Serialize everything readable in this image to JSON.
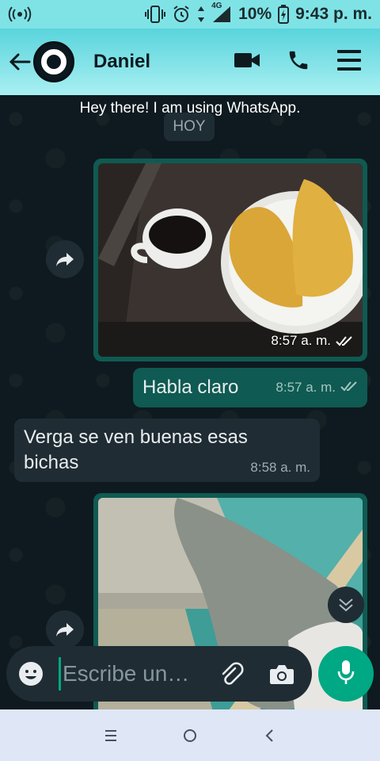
{
  "status_bar": {
    "battery": "10%",
    "time": "9:43 p. m.",
    "network": "4G",
    "icons": [
      "hotspot-icon",
      "vibrate-icon",
      "alarm-icon",
      "data-arrows-icon",
      "signal-icon",
      "battery-charging-icon"
    ]
  },
  "header": {
    "contact_name": "Daniel",
    "icons": [
      "back-arrow-icon",
      "avatar",
      "video-call-icon",
      "phone-call-icon",
      "menu-icon"
    ]
  },
  "chat": {
    "about": "Hey there! I am using WhatsApp.",
    "date_pill": "HOY",
    "messages": [
      {
        "type": "image",
        "direction": "out",
        "image_desc": "coffee-and-empanadas-photo",
        "time": "8:57 a. m.",
        "status": "read"
      },
      {
        "type": "text",
        "direction": "out",
        "text": "Habla claro",
        "time": "8:57 a. m.",
        "status": "read"
      },
      {
        "type": "text",
        "direction": "in",
        "text": "Verga se ven buenas esas bichas",
        "time": "8:58 a. m."
      },
      {
        "type": "image",
        "direction": "out",
        "image_desc": "blurred-photo"
      }
    ]
  },
  "composer": {
    "placeholder": "Escribe un…",
    "icons": [
      "emoji-icon",
      "attach-icon",
      "camera-icon",
      "mic-icon"
    ]
  },
  "nav": {
    "icons": [
      "recent-apps-icon",
      "home-icon",
      "back-icon"
    ]
  },
  "colors": {
    "status_bar": "#7fe3e6",
    "app_bar": "#59d4dc",
    "outgoing_bubble": "#0f5a52",
    "incoming_bubble": "#1f2c33",
    "accent": "#00a884",
    "nav_bar": "#dfe6f6"
  }
}
